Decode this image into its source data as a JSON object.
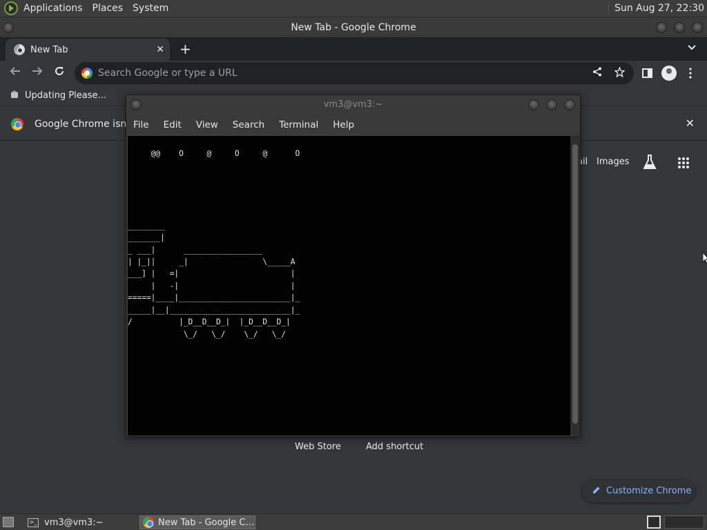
{
  "top_panel": {
    "menus": [
      "Applications",
      "Places",
      "System"
    ],
    "clock": "Sun Aug 27, 22:30"
  },
  "chrome": {
    "window_title": "New Tab - Google Chrome",
    "tab_title": "New Tab",
    "tab_close": "✕",
    "new_tab": "+",
    "tab_search": "⌄",
    "omnibox_placeholder": "Search Google or type a URL",
    "bookmark": "Updating Please…",
    "infobar_text": "Google Chrome isn't y",
    "infobar_close": "✕",
    "ntp_link_gmail": "ail",
    "ntp_link_images": "Images",
    "shortcuts": [
      "Web Store",
      "Add shortcut"
    ],
    "customize_label": "Customize Chrome"
  },
  "terminal": {
    "title": "vm3@vm3:~",
    "menus": [
      "File",
      "Edit",
      "View",
      "Search",
      "Terminal",
      "Help"
    ],
    "screen_lines": [
      "",
      "     @@    O     @     O     @      O",
      "",
      "",
      "",
      "",
      "",
      "________",
      "_______|",
      "_ ___|      _________________",
      "| |_||     _|                \\_____A",
      "___] |   =|                        |",
      "     |   -|                        |",
      "=====|____|________________________|_",
      "_____|__|__________________________|_",
      "/          |_D__D__D_|  |_D__D__D_|",
      "            \\_/   \\_/    \\_/   \\_/"
    ]
  },
  "taskbar": {
    "items": [
      "vm3@vm3:~",
      "New Tab - Google C…"
    ]
  }
}
